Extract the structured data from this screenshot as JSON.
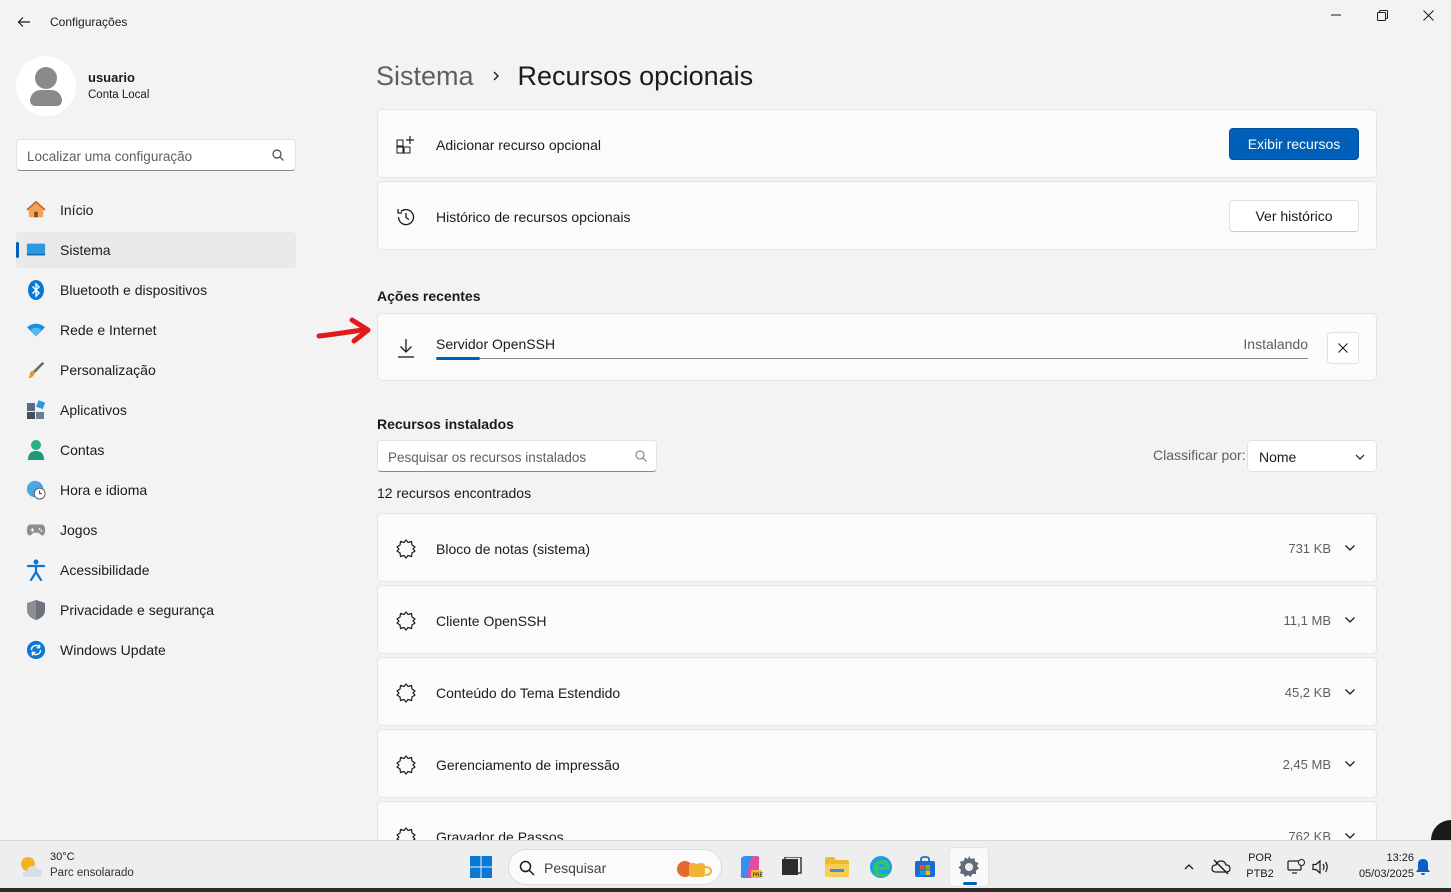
{
  "window": {
    "title": "Configurações"
  },
  "user": {
    "name": "usuario",
    "account_type": "Conta Local"
  },
  "sidebar": {
    "search_placeholder": "Localizar uma configuração",
    "items": [
      {
        "label": "Início",
        "icon": "home-icon"
      },
      {
        "label": "Sistema",
        "icon": "monitor-icon",
        "active": true
      },
      {
        "label": "Bluetooth e dispositivos",
        "icon": "bluetooth-icon"
      },
      {
        "label": "Rede e Internet",
        "icon": "wifi-icon"
      },
      {
        "label": "Personalização",
        "icon": "brush-icon"
      },
      {
        "label": "Aplicativos",
        "icon": "apps-icon"
      },
      {
        "label": "Contas",
        "icon": "person-icon"
      },
      {
        "label": "Hora e idioma",
        "icon": "globe-clock-icon"
      },
      {
        "label": "Jogos",
        "icon": "gamepad-icon"
      },
      {
        "label": "Acessibilidade",
        "icon": "accessibility-icon"
      },
      {
        "label": "Privacidade e segurança",
        "icon": "shield-icon"
      },
      {
        "label": "Windows Update",
        "icon": "update-icon"
      }
    ]
  },
  "breadcrumb": {
    "parent": "Sistema",
    "current": "Recursos opcionais"
  },
  "add_feature": {
    "label": "Adicionar recurso opcional",
    "button": "Exibir recursos"
  },
  "history": {
    "label": "Histórico de recursos opcionais",
    "button": "Ver histórico"
  },
  "recent": {
    "title": "Ações recentes",
    "item": {
      "name": "Servidor OpenSSH",
      "status": "Instalando",
      "progress": 0.05
    }
  },
  "installed": {
    "title": "Recursos instalados",
    "search_placeholder": "Pesquisar os recursos instalados",
    "sort_label": "Classificar por:",
    "sort_value": "Nome",
    "count_text": "12 recursos encontrados",
    "items": [
      {
        "name": "Bloco de notas (sistema)",
        "size": "731 KB"
      },
      {
        "name": "Cliente OpenSSH",
        "size": "11,1 MB"
      },
      {
        "name": "Conteúdo do Tema Estendido",
        "size": "45,2 KB"
      },
      {
        "name": "Gerenciamento de impressão",
        "size": "2,45 MB"
      },
      {
        "name": "Gravador de Passos",
        "size": "762 KB"
      }
    ]
  },
  "taskbar": {
    "weather": {
      "temp": "30°C",
      "desc": "Parc ensolarado"
    },
    "search_label": "Pesquisar",
    "lang": {
      "line1": "POR",
      "line2": "PTB2"
    },
    "time": "13:26",
    "date": "05/03/2025"
  },
  "colors": {
    "accent": "#005fb8",
    "annotation_arrow": "#e01b1b"
  }
}
